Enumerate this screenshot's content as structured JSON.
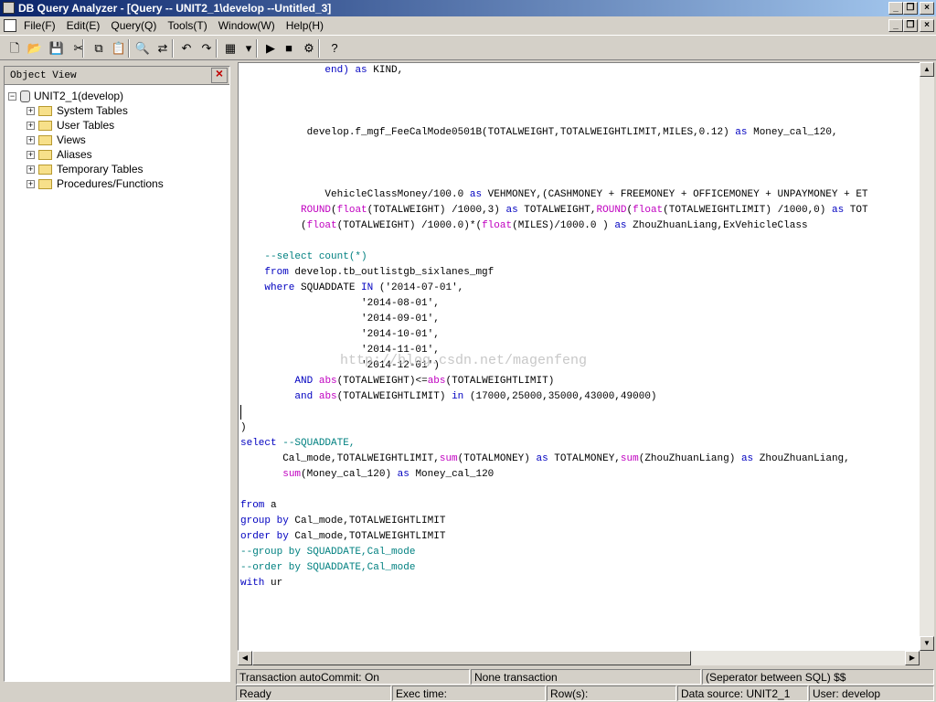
{
  "window": {
    "title": "DB Query Analyzer - [Query -- UNIT2_1\\develop --Untitled_3]",
    "app_icon": "db-analyzer-icon",
    "min": "_",
    "max": "❐",
    "close": "×"
  },
  "menu": [
    "File(F)",
    "Edit(E)",
    "Query(Q)",
    "Tools(T)",
    "Window(W)",
    "Help(H)"
  ],
  "toolbar": {
    "icons": [
      "new-file-icon",
      "open-folder-icon",
      "save-icon",
      "cut-icon",
      "copy-icon",
      "paste-icon",
      "find-icon",
      "replace-icon",
      "undo-icon",
      "redo-icon",
      "results-grid-icon",
      "dropdown-icon",
      "execute-icon",
      "stop-icon",
      "explain-icon",
      "help-icon"
    ],
    "glyphs": [
      "🗋",
      "📂",
      "💾",
      "✂",
      "⧉",
      "📋",
      "🔍",
      "⇄",
      "↶",
      "↷",
      "▦",
      "▾",
      "▶",
      "■",
      "⚙",
      "?"
    ]
  },
  "object_view": {
    "title": "Object View",
    "close": "×",
    "root": "UNIT2_1(develop)",
    "items": [
      "System Tables",
      "User Tables",
      "Views",
      "Aliases",
      "Temporary Tables",
      "Procedures/Functions"
    ]
  },
  "editor": {
    "lines": [
      [
        {
          "t": "              "
        },
        {
          "t": "end)",
          "c": "kw"
        },
        {
          "t": " "
        },
        {
          "t": "as",
          "c": "kw"
        },
        {
          "t": " KIND,"
        }
      ],
      [],
      [],
      [],
      [
        {
          "t": "           develop.f_mgf_FeeCalMode0501B(TOTALWEIGHT,TOTALWEIGHTLIMIT,MILES,0.12) "
        },
        {
          "t": "as",
          "c": "kw"
        },
        {
          "t": " Money_cal_120,"
        }
      ],
      [],
      [],
      [],
      [
        {
          "t": "              VehicleClassMoney/100.0 "
        },
        {
          "t": "as",
          "c": "kw"
        },
        {
          "t": " VEHMONEY,(CASHMONEY + FREEMONEY + OFFICEMONEY + UNPAYMONEY + ET"
        }
      ],
      [
        {
          "t": "          "
        },
        {
          "t": "ROUND",
          "c": "fn"
        },
        {
          "t": "("
        },
        {
          "t": "float",
          "c": "fn"
        },
        {
          "t": "(TOTALWEIGHT) /1000,3) "
        },
        {
          "t": "as",
          "c": "kw"
        },
        {
          "t": " TOTALWEIGHT,"
        },
        {
          "t": "ROUND",
          "c": "fn"
        },
        {
          "t": "("
        },
        {
          "t": "float",
          "c": "fn"
        },
        {
          "t": "(TOTALWEIGHTLIMIT) /1000,0) "
        },
        {
          "t": "as",
          "c": "kw"
        },
        {
          "t": " TOT"
        }
      ],
      [
        {
          "t": "          ("
        },
        {
          "t": "float",
          "c": "fn"
        },
        {
          "t": "(TOTALWEIGHT) /1000.0)*("
        },
        {
          "t": "float",
          "c": "fn"
        },
        {
          "t": "(MILES)/1000.0 ) "
        },
        {
          "t": "as",
          "c": "kw"
        },
        {
          "t": " ZhouZhuanLiang,ExVehicleClass"
        }
      ],
      [],
      [
        {
          "t": "    "
        },
        {
          "t": "--select count(*)",
          "c": "cm"
        }
      ],
      [
        {
          "t": "    "
        },
        {
          "t": "from",
          "c": "kw"
        },
        {
          "t": " develop.tb_outlistgb_sixlanes_mgf"
        }
      ],
      [
        {
          "t": "    "
        },
        {
          "t": "where",
          "c": "kw"
        },
        {
          "t": " SQUADDATE "
        },
        {
          "t": "IN",
          "c": "kw"
        },
        {
          "t": " ('2014-07-01',"
        }
      ],
      [
        {
          "t": "                    '2014-08-01',"
        }
      ],
      [
        {
          "t": "                    '2014-09-01',"
        }
      ],
      [
        {
          "t": "                    '2014-10-01',"
        }
      ],
      [
        {
          "t": "                    '2014-11-01',"
        }
      ],
      [
        {
          "t": "                    '2014-12-01')"
        }
      ],
      [
        {
          "t": "         "
        },
        {
          "t": "AND",
          "c": "kw"
        },
        {
          "t": " "
        },
        {
          "t": "abs",
          "c": "fn"
        },
        {
          "t": "(TOTALWEIGHT)<="
        },
        {
          "t": "abs",
          "c": "fn"
        },
        {
          "t": "(TOTALWEIGHTLIMIT)"
        }
      ],
      [
        {
          "t": "         "
        },
        {
          "t": "and",
          "c": "kw"
        },
        {
          "t": " "
        },
        {
          "t": "abs",
          "c": "fn"
        },
        {
          "t": "(TOTALWEIGHTLIMIT) "
        },
        {
          "t": "in",
          "c": "kw"
        },
        {
          "t": " (17000,25000,35000,43000,49000)"
        }
      ],
      [],
      [
        {
          "t": ")"
        }
      ],
      [
        {
          "t": "select",
          "c": "kw"
        },
        {
          "t": " "
        },
        {
          "t": "--SQUADDATE,",
          "c": "cm"
        }
      ],
      [
        {
          "t": "       Cal_mode,TOTALWEIGHTLIMIT,"
        },
        {
          "t": "sum",
          "c": "fn"
        },
        {
          "t": "(TOTALMONEY) "
        },
        {
          "t": "as",
          "c": "kw"
        },
        {
          "t": " TOTALMONEY,"
        },
        {
          "t": "sum",
          "c": "fn"
        },
        {
          "t": "(ZhouZhuanLiang) "
        },
        {
          "t": "as",
          "c": "kw"
        },
        {
          "t": " ZhouZhuanLiang,"
        }
      ],
      [
        {
          "t": "       "
        },
        {
          "t": "sum",
          "c": "fn"
        },
        {
          "t": "(Money_cal_120) "
        },
        {
          "t": "as",
          "c": "kw"
        },
        {
          "t": " Money_cal_120"
        }
      ],
      [],
      [
        {
          "t": "from",
          "c": "kw"
        },
        {
          "t": " a"
        }
      ],
      [
        {
          "t": "group by",
          "c": "kw"
        },
        {
          "t": " Cal_mode,TOTALWEIGHTLIMIT"
        }
      ],
      [
        {
          "t": "order by",
          "c": "kw"
        },
        {
          "t": " Cal_mode,TOTALWEIGHTLIMIT"
        }
      ],
      [
        {
          "t": "--group by SQUADDATE,Cal_mode",
          "c": "cm"
        }
      ],
      [
        {
          "t": "--order by SQUADDATE,Cal_mode",
          "c": "cm"
        }
      ],
      [
        {
          "t": "with",
          "c": "kw"
        },
        {
          "t": " ur"
        }
      ]
    ],
    "watermark": "http://blog.csdn.net/magenfeng"
  },
  "status": {
    "autocommit": "Transaction autoCommit: On",
    "transaction": "None transaction",
    "separator": "(Seperator between SQL)  $$",
    "ready": "Ready",
    "exec_time": "Exec time:",
    "rows": "Row(s):",
    "datasource": "Data source: UNIT2_1",
    "user": "User: develop"
  },
  "colors": {
    "title_bar": "#0a246a",
    "keyword": "#0000c0",
    "function": "#c000c0",
    "comment": "#008080"
  }
}
